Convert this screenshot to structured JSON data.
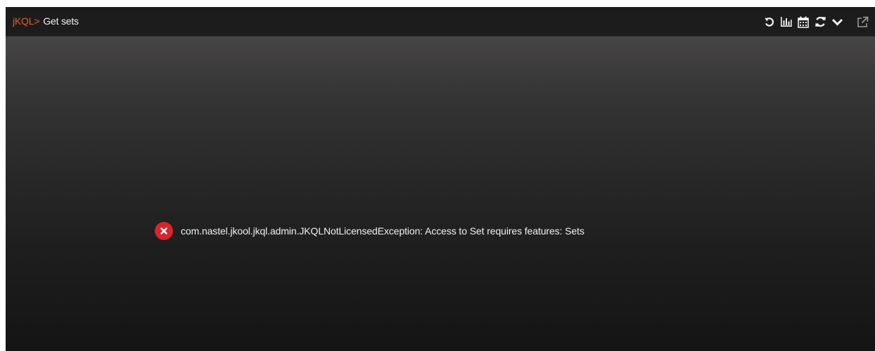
{
  "window": {
    "prompt": "jKQL>",
    "query": "Get sets"
  },
  "toolbar": {
    "icons": [
      "undo-icon",
      "bar-chart-icon",
      "calendar-icon",
      "refresh-icon",
      "chevron-down-icon",
      "external-link-icon"
    ]
  },
  "error": {
    "icon": "error-circle-x-icon",
    "message": "com.nastel.jkool.jkql.admin.JKQLNotLicensedException: Access to Set requires features: Sets"
  },
  "colors": {
    "prompt": "#e2622b",
    "error": "#d6262b"
  }
}
